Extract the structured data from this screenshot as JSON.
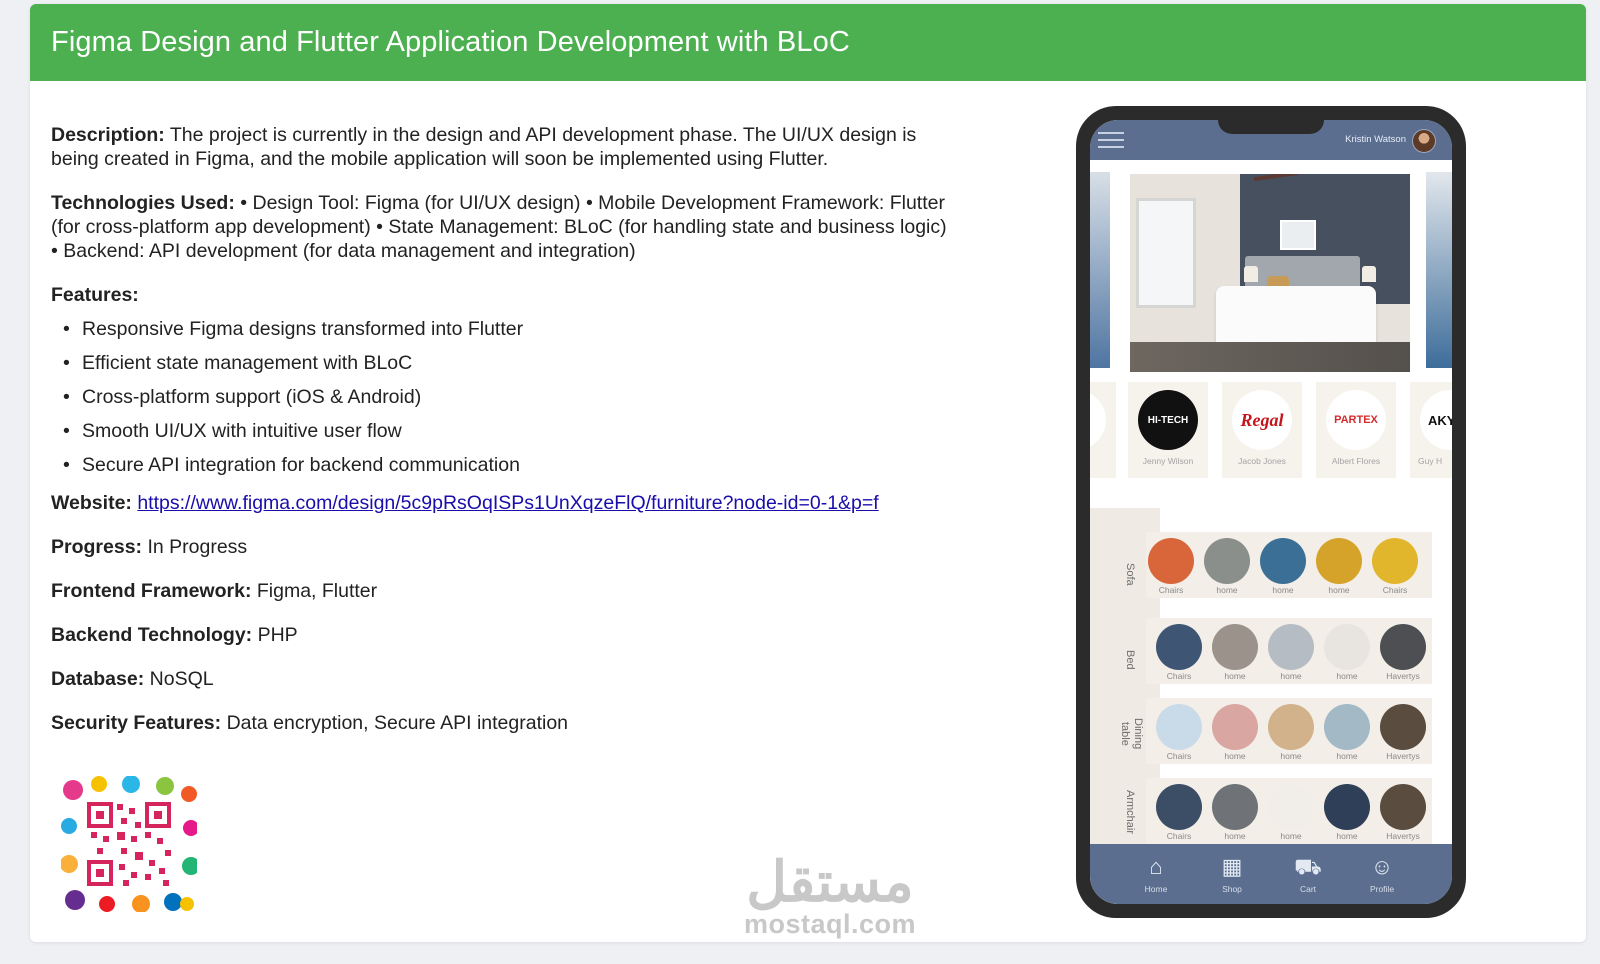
{
  "header": {
    "title": "Figma Design and Flutter Application Development with BLoC"
  },
  "description": {
    "label": "Description:",
    "text": " The project is currently in the design and API development phase. The UI/UX design is being created in Figma, and the mobile application will soon be implemented using Flutter."
  },
  "technologies": {
    "label": "Technologies Used:",
    "text": " • Design Tool: Figma (for UI/UX design) • Mobile Development Framework: Flutter (for cross-platform app development) • State Management: BLoC (for handling state and business logic) • Backend: API development (for data management and integration)"
  },
  "features": {
    "label": "Features:",
    "items": [
      "Responsive Figma designs transformed into Flutter",
      "Efficient state management with BLoC",
      "Cross-platform support (iOS & Android)",
      "Smooth UI/UX with intuitive user flow",
      "Secure API integration for backend communication"
    ]
  },
  "website": {
    "label": "Website:",
    "url": "https://www.figma.com/design/5c9pRsOqISPs1UnXqzeFlQ/furniture?node-id=0-1&p=f"
  },
  "progress": {
    "label": "Progress:",
    "value": " In Progress"
  },
  "frontend": {
    "label": "Frontend Framework:",
    "value": " Figma, Flutter"
  },
  "backend": {
    "label": "Backend Technology:",
    "value": " PHP"
  },
  "database": {
    "label": "Database:",
    "value": " NoSQL"
  },
  "security": {
    "label": "Security Features:",
    "value": " Data encryption, Secure API integration"
  },
  "watermark": {
    "arabic": "مستقل",
    "latin": "mostaql.com"
  },
  "phone": {
    "user_name": "Kristin Watson",
    "brands": [
      {
        "logo": "HI-TECH",
        "name": "Jenny Wilson"
      },
      {
        "logo": "Regal",
        "name": "Jacob Jones"
      },
      {
        "logo": "PARTEX",
        "name": "Albert Flores"
      },
      {
        "logo": "AKY",
        "name": "Guy H"
      }
    ],
    "categories": [
      {
        "name": "Sofa",
        "items": [
          "Chairs",
          "home",
          "home",
          "home",
          "Chairs"
        ]
      },
      {
        "name": "Bed",
        "items": [
          "Chairs",
          "home",
          "home",
          "home",
          "Havertys"
        ]
      },
      {
        "name": "Dining table",
        "items": [
          "Chairs",
          "home",
          "home",
          "home",
          "Havertys"
        ]
      },
      {
        "name": "Armchair",
        "items": [
          "Chairs",
          "home",
          "home",
          "home",
          "Havertys"
        ]
      }
    ],
    "nav": [
      "Home",
      "Shop",
      "Cart",
      "Profile"
    ]
  },
  "colors": {
    "header_green": "#4caf50",
    "app_blue": "#5b6e8f",
    "link": "#1a0dab"
  }
}
